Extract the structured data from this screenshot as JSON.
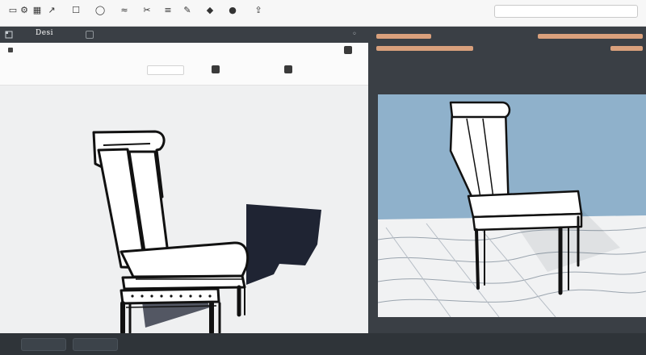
{
  "toolbar": {
    "tools": [
      {
        "icon": "square-icon",
        "glyph": "▭",
        "label": ""
      },
      {
        "icon": "gear-icon",
        "glyph": "⚙",
        "label": ""
      },
      {
        "icon": "grid-icon",
        "glyph": "▦",
        "label": ""
      },
      {
        "icon": "arrow-icon",
        "glyph": "↗",
        "label": ""
      },
      {
        "icon": "chat-icon",
        "glyph": "☐",
        "label": ""
      },
      {
        "icon": "circle-icon",
        "glyph": "◯",
        "label": ""
      },
      {
        "icon": "wave-icon",
        "glyph": "≈",
        "label": ""
      },
      {
        "icon": "scissors-icon",
        "glyph": "✂",
        "label": ""
      },
      {
        "icon": "layers-icon",
        "glyph": "≡",
        "label": ""
      },
      {
        "icon": "pen-icon",
        "glyph": "✎",
        "label": ""
      },
      {
        "icon": "shape-icon",
        "glyph": "◆",
        "label": ""
      },
      {
        "icon": "dot-icon",
        "glyph": "●",
        "label": ""
      },
      {
        "icon": "share-icon",
        "glyph": "⇪",
        "label": ""
      }
    ],
    "search_placeholder": ""
  },
  "left_panel": {
    "title": "Desi",
    "close_glyph": "◦"
  },
  "props": {
    "row1": [
      "",
      "",
      "",
      "",
      "",
      "",
      ""
    ],
    "row2": [
      "",
      "",
      "",
      "",
      "",
      "",
      ""
    ]
  },
  "right_panel": {
    "caption": "",
    "bars": [
      "",
      "",
      ""
    ]
  },
  "status": {
    "left": [
      "",
      "",
      ""
    ],
    "center": "",
    "right": ""
  },
  "colors": {
    "accent": "#d9a07c",
    "panel_dark": "#3a3f45",
    "viewport_blue": "#8fb1cb"
  }
}
